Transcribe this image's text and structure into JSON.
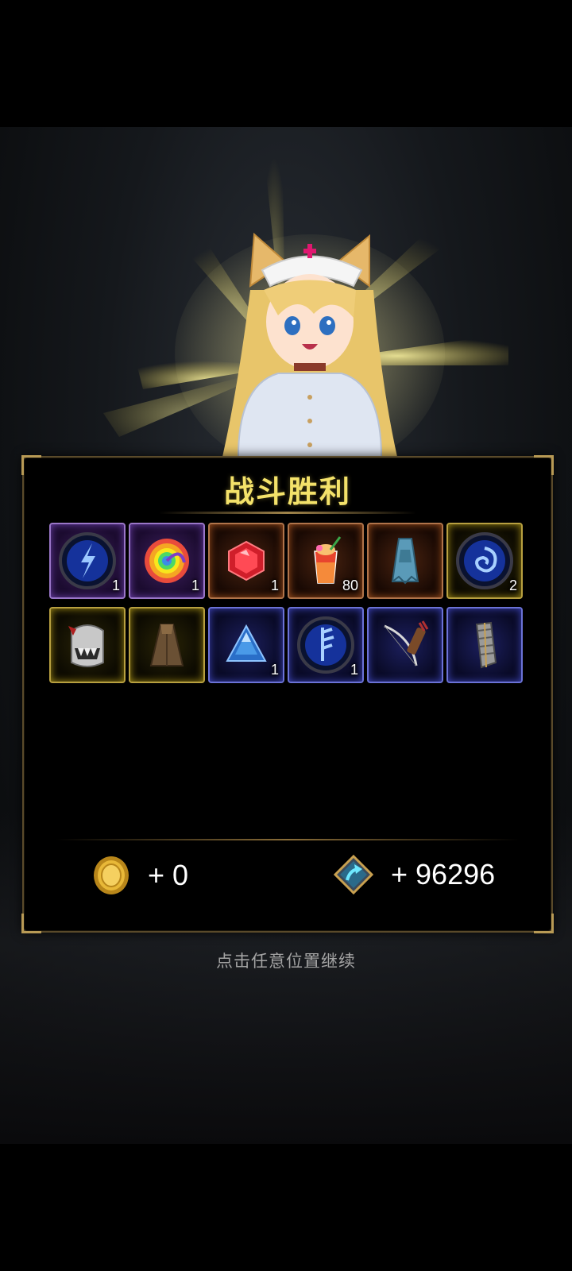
{
  "title": "战斗胜利",
  "items": [
    {
      "name": "blue-rune-orb",
      "rarity": "purple",
      "count": "1"
    },
    {
      "name": "rainbow-swirl",
      "rarity": "purple",
      "count": "1"
    },
    {
      "name": "red-gem",
      "rarity": "orange",
      "count": "1"
    },
    {
      "name": "cocktail-drink",
      "rarity": "orange",
      "count": "80"
    },
    {
      "name": "blue-robe",
      "rarity": "orange",
      "count": ""
    },
    {
      "name": "blue-swirl-orb",
      "rarity": "gold",
      "count": "2"
    },
    {
      "name": "skull-helmet",
      "rarity": "gold",
      "count": ""
    },
    {
      "name": "brown-cloak",
      "rarity": "gold",
      "count": ""
    },
    {
      "name": "blue-triangle-crystal",
      "rarity": "blue",
      "count": "1"
    },
    {
      "name": "blue-lightning-orb",
      "rarity": "blue",
      "count": "1"
    },
    {
      "name": "bow-and-quiver",
      "rarity": "blue",
      "count": ""
    },
    {
      "name": "metal-gauntlet",
      "rarity": "blue",
      "count": ""
    }
  ],
  "rewards": {
    "gold": {
      "icon": "gold-coin-icon",
      "label": "+ 0"
    },
    "exp": {
      "icon": "exp-up-arrow-icon",
      "label": "+ 96296"
    }
  },
  "hint": "点击任意位置继续",
  "colors": {
    "title": "#f4e26a",
    "purple": "#9a76c8",
    "orange": "#b0744a",
    "gold": "#b8a040",
    "blue": "#6b72d6"
  }
}
